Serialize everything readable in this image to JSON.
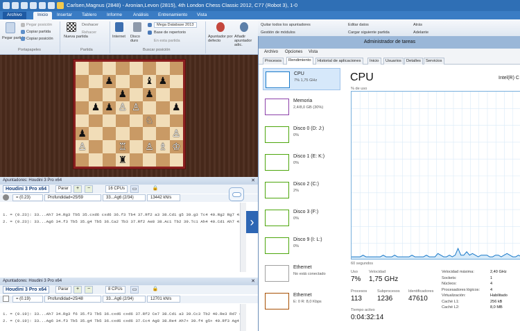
{
  "window": {
    "title": "Carlsen,Magnus (2848) - Aronian,Levon (2815), 4th London Chess Classic 2012, C77 (Robot 3), 1-0"
  },
  "menu": {
    "tabs": [
      "Archivo",
      "Inicio",
      "Insertar",
      "Tablero",
      "Informe",
      "Análisis",
      "Entrenamiento",
      "Vista"
    ],
    "active": "Inicio"
  },
  "ribbon": {
    "paste": "Pegar partida",
    "paste_position": "Pegar posición",
    "copy_game": "Copiar partida",
    "copy_position": "Copiar posición",
    "clipboard_group": "Portapapeles",
    "new_game": "Nueva partida",
    "undo": "Deshacer",
    "redo": "Rehacer",
    "game_group": "Partida",
    "internet": "Internet",
    "disco_duro": "Disco duro",
    "mega_database": "Mega Database 2013",
    "repertoire": "Base de repertorio",
    "in_this_game": "En esta partida",
    "search_group": "Buscar posición",
    "add_engine": "Apuntador por defecto",
    "add_engine2": "Añadir apuntador adic.",
    "remove_all": "Quitar todos los apuntadores",
    "manage_modules": "Gestión de módulos",
    "edit_data": "Editar datos",
    "load_next": "Cargar siguiente partida",
    "back": "Atrás",
    "forward": "Adelante"
  },
  "engine_panes": [
    {
      "title": "Apuntadores: Houdini 3 Pro x64",
      "name": "Houdini 3 Pro x64",
      "stop": "Parar",
      "cpus": "16 CPUs",
      "eval": "= (0.23)",
      "depth": "Profundidad=25/59",
      "move": "33...Ag6 (2/34)",
      "speed": "13442 kN/s",
      "lines": [
        "1. = (0.23): 33...Ah7 34.Rg3 Tb5 35.cxd6 cxd6 36.f3 Tb4 37.Rf2 a3 38.Cd1 g5 39.g3 Tc4 40.Rg2 Rg7 41.g4",
        "2. = (0.23): 33...Ag6 34.f3 Tb5 35.g4 Tb5 36.Ca2 Tb3 37.Rf2 Ae8 38.Ac1 Tb2 39.Tc1 Ah4 40.Cd1 Ah7 41.Rf2"
      ]
    },
    {
      "title": "Apuntadores: Houdini 3 Pro x64",
      "name": "Houdini 3 Pro x64",
      "stop": "Parar",
      "cpus": "8 CPUs",
      "eval": "= (0.19)",
      "depth": "Profundidad=25/48",
      "move": "33...Ag6 (2/34)",
      "speed": "12701 kN/s",
      "lines": [
        "1. = (0.19): 33...Ah7 34.Rg3 f6 35.f3 Tb5 36.cxd6 cxd6 37.Rf2 Ce7 38.Cd1 a3 39.Cc3 Tb2 40.Re3 Rd7 41.h4 g5 4",
        "2. = (0.19): 33...Ag6 34.f3 Tb5 35.g4 Tb5 36.cxd6 cxd6 37.Cc4 Ag8 38.Re4 Ah7+ 39.f4 g5+ 40.Rf3 Ag4 41.Ce4 Ce"
      ]
    }
  ],
  "board": {
    "rows": [
      [
        "",
        "",
        "",
        "",
        "",
        "",
        "",
        ""
      ],
      [
        "",
        "",
        "bp",
        "",
        "",
        "bb",
        "bp",
        ""
      ],
      [
        "",
        "",
        "",
        "bp",
        "",
        "bp",
        "",
        ""
      ],
      [
        "",
        "bp",
        "bp",
        "wp",
        "wp",
        "",
        "",
        "bp"
      ],
      [
        "",
        "",
        "",
        "",
        "",
        "wn",
        "",
        ""
      ],
      [
        "bp",
        "",
        "",
        "",
        "",
        "",
        "",
        "wp"
      ],
      [
        "wp",
        "",
        "",
        "wr",
        "",
        "wp",
        "wb",
        "wk"
      ],
      [
        "",
        "",
        "",
        "br",
        "",
        "",
        "",
        ""
      ]
    ]
  },
  "taskmanager": {
    "title": "Administrador de tareas",
    "menu": [
      "Archivo",
      "Opciones",
      "Vista"
    ],
    "tabs": [
      "Procesos",
      "Rendimiento",
      "Historial de aplicaciones",
      "Inicio",
      "Usuarios",
      "Detalles",
      "Servicios"
    ],
    "active_tab": "Rendimiento",
    "resources": [
      {
        "name": "CPU",
        "value": "7% 1,75 GHz",
        "color": "#1979c9"
      },
      {
        "name": "Memoria",
        "value": "2,4/8,0 GB (30%)",
        "color": "#8b3fa8"
      },
      {
        "name": "Disco 0 (D: J:)",
        "value": "0%",
        "color": "#4da60c"
      },
      {
        "name": "Disco 1 (E: K:)",
        "value": "0%",
        "color": "#4da60c"
      },
      {
        "name": "Disco 2 (C:)",
        "value": "2%",
        "color": "#4da60c"
      },
      {
        "name": "Disco 3 (F:)",
        "value": "0%",
        "color": "#4da60c"
      },
      {
        "name": "Disco 9 (I: L:)",
        "value": "0%",
        "color": "#4da60c"
      },
      {
        "name": "Ethernet",
        "value": "No está conectado",
        "color": "#a0a0a0"
      },
      {
        "name": "Ethernet",
        "value": "E: 0 R: 8,0 Kbps",
        "color": "#a74f01"
      }
    ],
    "cpu": {
      "heading": "CPU",
      "model": "Intel(R) C",
      "util_label": "% de uso",
      "secs_label": "60 segundos",
      "uso_label": "Uso",
      "uso": "7%",
      "speed_label": "Velocidad",
      "speed": "1,75 GHz",
      "processes_label": "Procesos",
      "processes": "113",
      "threads_label": "Subprocesos",
      "threads": "1236",
      "handles_label": "Identificadores",
      "handles": "47610",
      "uptime_label": "Tiempo activo",
      "uptime": "0:04:32:14",
      "details": [
        {
          "label": "Velocidad máxima:",
          "value": "2,40 GHz"
        },
        {
          "label": "Sockets:",
          "value": "1"
        },
        {
          "label": "Núcleos:",
          "value": "4"
        },
        {
          "label": "Procesadores lógicos:",
          "value": "4"
        },
        {
          "label": "Virtualización:",
          "value": "Habilitado"
        },
        {
          "label": "Caché L1:",
          "value": "256 kB"
        },
        {
          "label": "Caché L2:",
          "value": "8,0 MB"
        }
      ],
      "history": [
        2,
        2,
        2,
        2,
        3,
        2,
        2,
        2,
        2,
        2,
        2,
        3,
        2,
        2,
        2,
        3,
        2,
        2,
        2,
        2,
        2,
        3,
        2,
        2,
        2,
        2,
        3,
        2,
        2,
        2,
        4,
        3,
        2,
        2,
        3,
        2,
        3,
        7,
        3,
        3,
        5,
        3,
        4,
        3,
        2,
        3,
        3,
        3,
        2,
        2,
        3,
        3,
        2,
        3,
        4,
        3,
        2,
        2,
        3,
        2
      ]
    }
  }
}
